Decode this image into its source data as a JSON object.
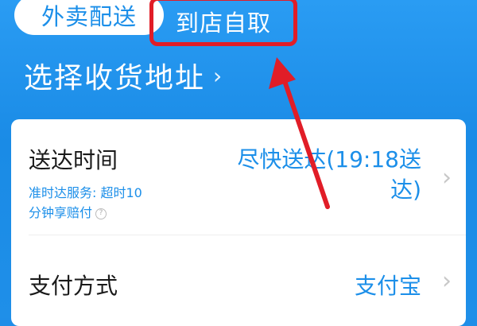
{
  "tabs": [
    {
      "label": "外卖配送",
      "active": true
    },
    {
      "label": "到店自取",
      "active": false,
      "highlighted": true
    }
  ],
  "address": {
    "title": "选择收货地址",
    "chevron": "›"
  },
  "delivery": {
    "label": "送达时间",
    "note_line1": "准时达服务: 超时10",
    "note_line2": "分钟享赔付",
    "value": "尽快送达(19:18送达)",
    "help_icon": "question-circle-icon"
  },
  "payment": {
    "label": "支付方式",
    "value": "支付宝"
  },
  "colors": {
    "brand_blue": "#1c8fe9",
    "highlight_red": "#e11d27"
  }
}
